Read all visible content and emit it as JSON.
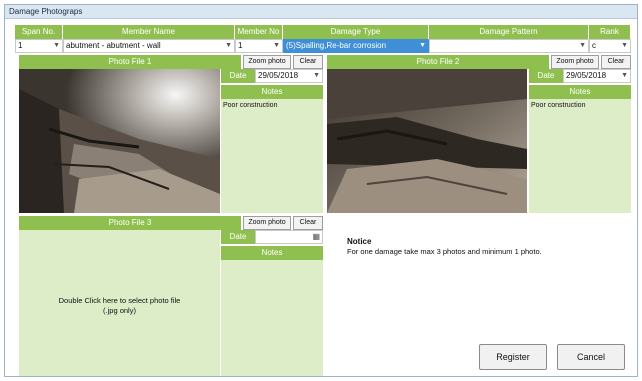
{
  "window": {
    "title": "Damage Photograps"
  },
  "header": {
    "span_no": "Span No.",
    "member_name": "Member Name",
    "member_no": "Member No",
    "damage_type": "Damage Type",
    "damage_pattern": "Damage Pattern",
    "rank": "Rank"
  },
  "row": {
    "span_no": "1",
    "member_name": "abutment - abutment - wall",
    "member_no": "1",
    "damage_type": "(5)Spalling,Re-bar corrosion",
    "damage_pattern": "",
    "rank": "c"
  },
  "photo1": {
    "title": "Photo File 1",
    "zoom": "Zoom photo",
    "clear": "Clear",
    "date_label": "Date",
    "date_value": "29/05/2018",
    "notes_label": "Notes",
    "notes_value": "Poor construction"
  },
  "photo2": {
    "title": "Photo File 2",
    "zoom": "Zoom photo",
    "clear": "Clear",
    "date_label": "Date",
    "date_value": "29/05/2018",
    "notes_label": "Notes",
    "notes_value": "Poor construction"
  },
  "photo3": {
    "title": "Photo File 3",
    "zoom": "Zoom photo",
    "clear": "Clear",
    "date_label": "Date",
    "date_value": "",
    "notes_label": "Notes",
    "notes_value": "",
    "placeholder_line1": "Double Click here to select photo file",
    "placeholder_line2": "(.jpg only)"
  },
  "notice": {
    "title": "Notice",
    "text": "For one damage take max 3 photos and minimum 1 photo."
  },
  "actions": {
    "register": "Register",
    "cancel": "Cancel"
  },
  "icons": {
    "dropdown": "chevron-down-icon",
    "calendar": "calendar-icon"
  },
  "colors": {
    "accent_green": "#8fc04f",
    "panel_green": "#dcedc8",
    "selection_blue": "#3f8fd6"
  }
}
